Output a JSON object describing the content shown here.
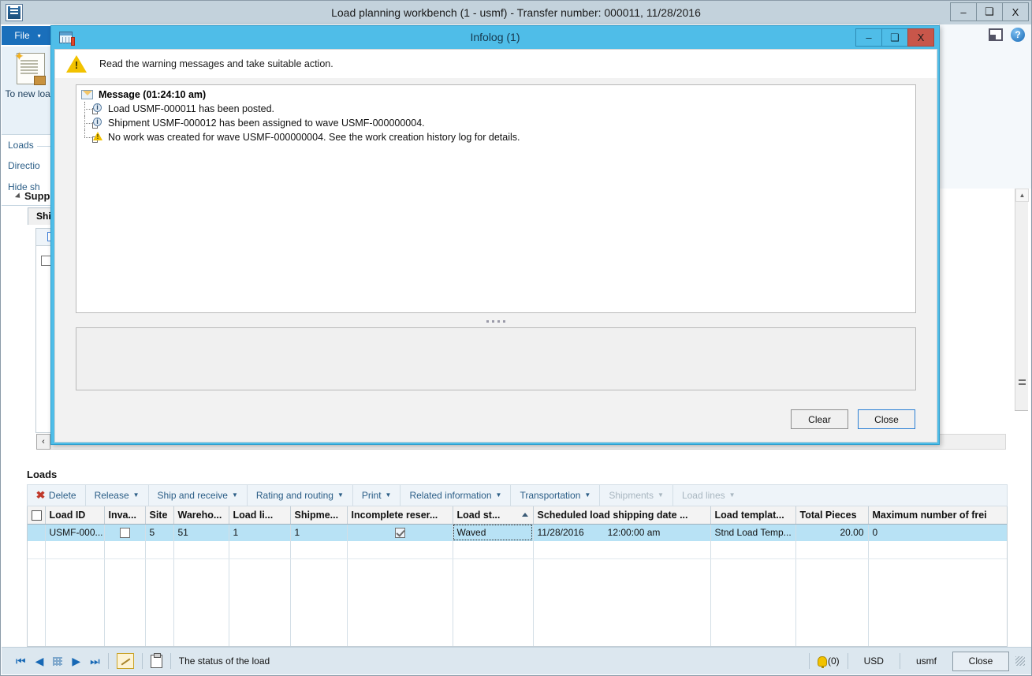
{
  "window": {
    "title": "Load planning workbench (1 - usmf) - Transfer number: 000011, 11/28/2016",
    "app_icon": "app-window-icon",
    "minimize": "–",
    "maximize": "❑",
    "close": "X"
  },
  "sidebar": {
    "file_tab": "File",
    "file_caret": "▾",
    "new_load_label": "To new load",
    "group_title": "Loads",
    "links": [
      "Directio",
      "Hide sh"
    ]
  },
  "background": {
    "expander_label": "Supp",
    "tab_label": "Shi"
  },
  "right_icons": {
    "panel": "panel-layout-icon",
    "help": "?"
  },
  "dialog": {
    "title": "Infolog (1)",
    "icon": "infolog-icon",
    "minimize": "–",
    "maximize": "❑",
    "close": "X",
    "warning_banner": "Read the warning messages and take suitable action.",
    "message_root": "Message (01:24:10 am)",
    "messages": [
      {
        "icon": "info-icon",
        "glyph": "i",
        "text": "Load USMF-000011 has been posted."
      },
      {
        "icon": "info-icon",
        "glyph": "i",
        "text": "Shipment USMF-000012 has been assigned to wave USMF-000000004."
      },
      {
        "icon": "warning-icon",
        "glyph": "!",
        "text": "No work was created for wave USMF-000000004. See the work creation history log for details."
      }
    ],
    "buttons": {
      "clear": "Clear",
      "close": "Close"
    }
  },
  "loads": {
    "heading": "Loads",
    "toolbar": [
      {
        "label": "Delete",
        "icon": "delete-x-icon",
        "caret": false,
        "disabled": false
      },
      {
        "label": "Release",
        "icon": null,
        "caret": true,
        "disabled": false
      },
      {
        "label": "Ship and receive",
        "icon": null,
        "caret": true,
        "disabled": false
      },
      {
        "label": "Rating and routing",
        "icon": null,
        "caret": true,
        "disabled": false
      },
      {
        "label": "Print",
        "icon": null,
        "caret": true,
        "disabled": false
      },
      {
        "label": "Related information",
        "icon": null,
        "caret": true,
        "disabled": false
      },
      {
        "label": "Transportation",
        "icon": null,
        "caret": true,
        "disabled": false
      },
      {
        "label": "Shipments",
        "icon": null,
        "caret": true,
        "disabled": true
      },
      {
        "label": "Load lines",
        "icon": null,
        "caret": true,
        "disabled": true
      }
    ],
    "columns": [
      "Load ID",
      "Inva...",
      "Site",
      "Wareho...",
      "Load li...",
      "Shipme...",
      "Incomplete reser...",
      "Load st...",
      "Scheduled load shipping date ...",
      "Load templat...",
      "Total Pieces",
      "Maximum number of frei"
    ],
    "sorted_column_index": 7,
    "row": {
      "load_id": "USMF-000...",
      "invalid_checked": false,
      "site": "5",
      "warehouse": "51",
      "load_lines": "1",
      "shipments": "1",
      "incomplete_reservation_checked": true,
      "load_status": "Waved",
      "ship_date": "11/28/2016",
      "ship_time": "12:00:00 am",
      "load_template": "Stnd Load Temp...",
      "total_pieces": "20.00",
      "max_freight": "0"
    }
  },
  "statusbar": {
    "nav": {
      "first": "⏮",
      "prev": "◀",
      "grid": "grid-icon",
      "next": "▶",
      "last": "⏭"
    },
    "edit_icon": "edit-pencil-icon",
    "copy_icon": "copy-icon",
    "status_text": "The status of the load",
    "notifications": "(0)",
    "currency": "USD",
    "company": "usmf",
    "close_label": "Close"
  },
  "colors": {
    "dialog_accent": "#4fbde8",
    "file_tab": "#1a6fbb",
    "row_selected": "#b8e2f5",
    "close_red": "#c8564a",
    "link": "#2a5d86",
    "warning_yellow": "#f2c200"
  }
}
